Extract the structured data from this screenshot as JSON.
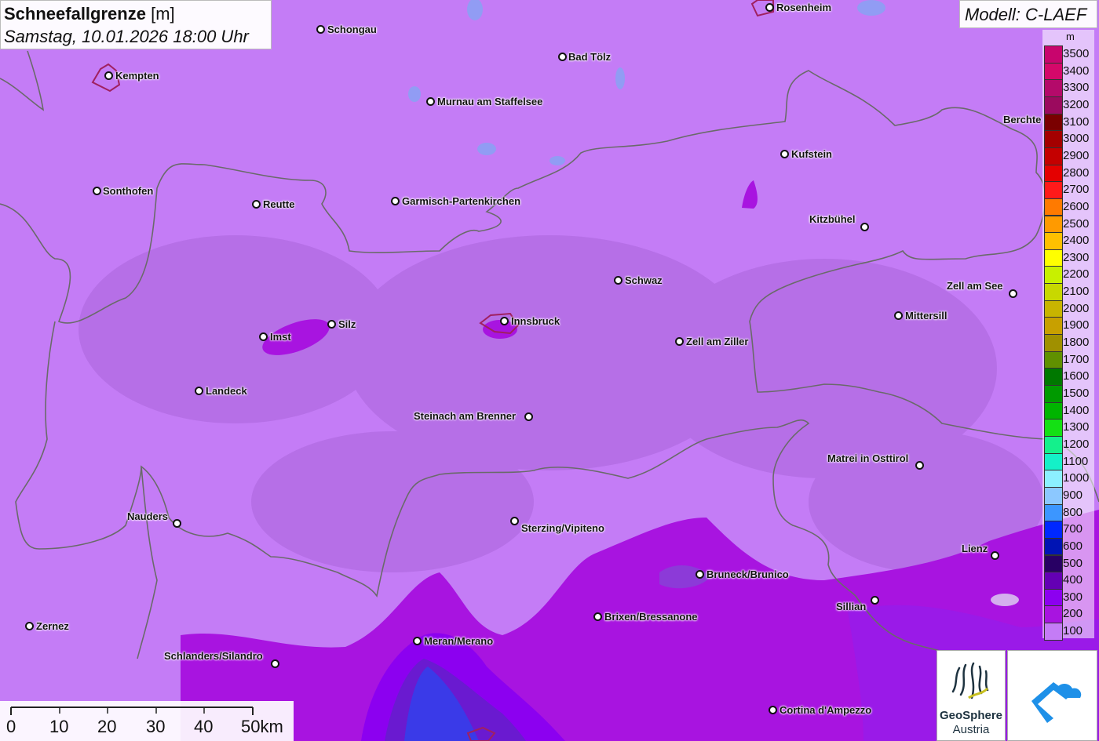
{
  "title": {
    "main": "Schneefallgrenze",
    "unit": "[m]",
    "date": "Samstag, 10.01.2026 18:00 Uhr"
  },
  "model": {
    "label": "Modell: C-LAEF"
  },
  "legend": {
    "unit": "m",
    "entries": [
      {
        "value": "3500",
        "color": "#c8056d"
      },
      {
        "value": "3400",
        "color": "#d4086a"
      },
      {
        "value": "3300",
        "color": "#b40a6a"
      },
      {
        "value": "3200",
        "color": "#9b0a5e"
      },
      {
        "value": "3100",
        "color": "#7a0000"
      },
      {
        "value": "3000",
        "color": "#a40000"
      },
      {
        "value": "2900",
        "color": "#c40000"
      },
      {
        "value": "2800",
        "color": "#e40000"
      },
      {
        "value": "2700",
        "color": "#ff1a1a"
      },
      {
        "value": "2600",
        "color": "#ff7a00"
      },
      {
        "value": "2500",
        "color": "#ff9a00"
      },
      {
        "value": "2400",
        "color": "#ffc000"
      },
      {
        "value": "2300",
        "color": "#ffff00"
      },
      {
        "value": "2200",
        "color": "#c8f000"
      },
      {
        "value": "2100",
        "color": "#c8d800"
      },
      {
        "value": "2000",
        "color": "#c8b400"
      },
      {
        "value": "1900",
        "color": "#c8a000"
      },
      {
        "value": "1800",
        "color": "#a09000"
      },
      {
        "value": "1700",
        "color": "#609000"
      },
      {
        "value": "1600",
        "color": "#007800"
      },
      {
        "value": "1500",
        "color": "#009a00"
      },
      {
        "value": "1400",
        "color": "#00b400"
      },
      {
        "value": "1300",
        "color": "#14e014"
      },
      {
        "value": "1200",
        "color": "#14f08c"
      },
      {
        "value": "1100",
        "color": "#14f0c8"
      },
      {
        "value": "1000",
        "color": "#8cf0ff"
      },
      {
        "value": "900",
        "color": "#8cc8ff"
      },
      {
        "value": "800",
        "color": "#3c96ff"
      },
      {
        "value": "700",
        "color": "#0028ff"
      },
      {
        "value": "600",
        "color": "#0014b4"
      },
      {
        "value": "500",
        "color": "#280064"
      },
      {
        "value": "400",
        "color": "#6400b4"
      },
      {
        "value": "300",
        "color": "#8c00f0"
      },
      {
        "value": "200",
        "color": "#a814e0"
      },
      {
        "value": "100",
        "color": "#c47cf6"
      }
    ]
  },
  "cities": [
    {
      "name": "Rosenheim"
    },
    {
      "name": "Schongau"
    },
    {
      "name": "Kempten"
    },
    {
      "name": "Bad Tölz"
    },
    {
      "name": "Murnau am Staffelsee"
    },
    {
      "name": "Berchte"
    },
    {
      "name": "Kufstein"
    },
    {
      "name": "Sonthofen"
    },
    {
      "name": "Reutte"
    },
    {
      "name": "Garmisch-Partenkirchen"
    },
    {
      "name": "Kitzbühel"
    },
    {
      "name": "Schwaz"
    },
    {
      "name": "Zell am See"
    },
    {
      "name": "Mittersill"
    },
    {
      "name": "Imst"
    },
    {
      "name": "Silz"
    },
    {
      "name": "Innsbruck"
    },
    {
      "name": "Zell am Ziller"
    },
    {
      "name": "Landeck"
    },
    {
      "name": "Steinach am Brenner"
    },
    {
      "name": "Matrei in Osttirol"
    },
    {
      "name": "Nauders"
    },
    {
      "name": "Sterzing/Vipiteno"
    },
    {
      "name": "Lienz"
    },
    {
      "name": "Bruneck/Brunico"
    },
    {
      "name": "Sillian"
    },
    {
      "name": "Brixen/Bressanone"
    },
    {
      "name": "Zernez"
    },
    {
      "name": "Meran/Merano"
    },
    {
      "name": "Schlanders/Silandro"
    },
    {
      "name": "Cortina d'Ampezzo"
    }
  ],
  "scale": {
    "labels": [
      "0",
      "10",
      "20",
      "30",
      "40",
      "50km"
    ]
  },
  "logos": {
    "geosphere_line1": "GeoSphere",
    "geosphere_line2": "Austria"
  }
}
